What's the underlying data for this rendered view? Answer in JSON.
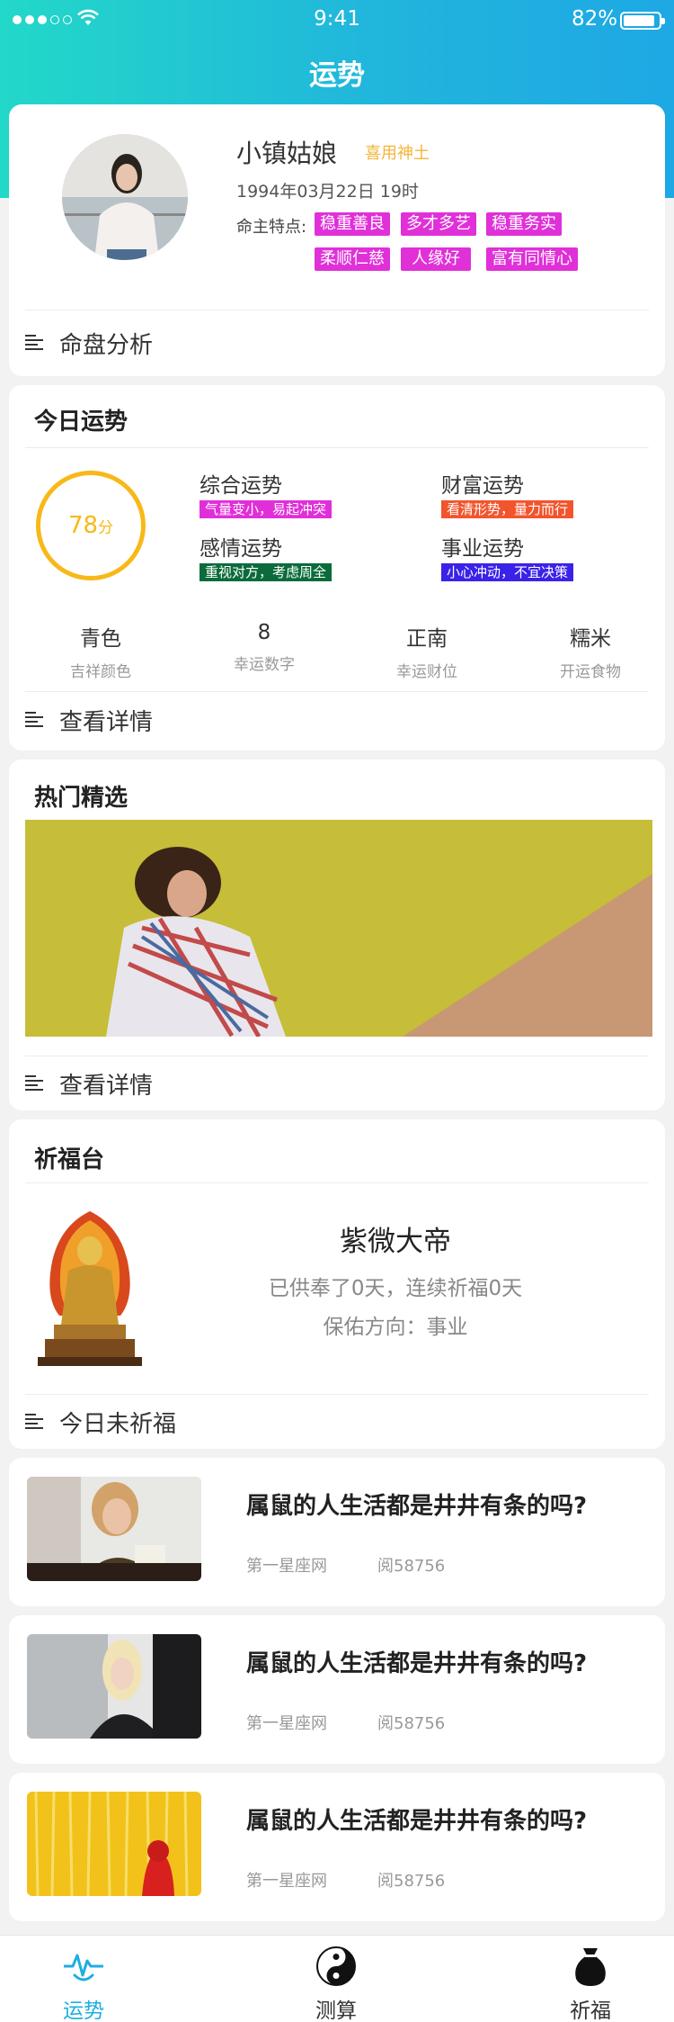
{
  "status_bar": {
    "time": "9:41",
    "battery": "82%"
  },
  "nav": {
    "title": "运势"
  },
  "profile": {
    "name": "小镇姑娘",
    "god": "喜用神土",
    "birth": "1994年03月22日  19时",
    "traits_label": "命主特点:",
    "traits": [
      "稳重善良",
      "多才多艺",
      "稳重务实",
      "柔顺仁慈",
      "人缘好",
      "富有同情心"
    ],
    "link": "命盘分析"
  },
  "today": {
    "title": "今日运势",
    "score": "78",
    "score_unit": "分",
    "items": [
      {
        "title": "综合运势",
        "desc": "气量变小，易起冲突",
        "color": "#e02fd8"
      },
      {
        "title": "财富运势",
        "desc": "看清形势，量力而行",
        "color": "#f2552d"
      },
      {
        "title": "感情运势",
        "desc": "重视对方，考虑周全",
        "color": "#0b6b3b"
      },
      {
        "title": "事业运势",
        "desc": "小心冲动，不宜决策",
        "color": "#3a22e8"
      }
    ],
    "lucky": [
      {
        "value": "青色",
        "label": "吉祥颜色"
      },
      {
        "value": "8",
        "label": "幸运数字"
      },
      {
        "value": "正南",
        "label": "幸运财位"
      },
      {
        "value": "糯米",
        "label": "开运食物"
      }
    ],
    "link": "查看详情"
  },
  "hot": {
    "title": "热门精选",
    "link": "查看详情"
  },
  "prayer": {
    "title": "祈福台",
    "deity": "紫微大帝",
    "status": "已供奉了0天，连续祈福0天",
    "direction": "保佑方向：事业",
    "link": "今日未祈福"
  },
  "articles": [
    {
      "title": "属鼠的人生活都是井井有条的吗?",
      "source": "第一星座网",
      "reads": "阅58756"
    },
    {
      "title": "属鼠的人生活都是井井有条的吗?",
      "source": "第一星座网",
      "reads": "阅58756"
    },
    {
      "title": "属鼠的人生活都是井井有条的吗?",
      "source": "第一星座网",
      "reads": "阅58756"
    }
  ],
  "tabs": [
    {
      "label": "运势",
      "icon": "pulse-face-icon"
    },
    {
      "label": "测算",
      "icon": "yin-yang-icon"
    },
    {
      "label": "祈福",
      "icon": "fortune-bag-icon"
    }
  ],
  "colors": {
    "accent": "#1eaee0",
    "tag": "#e030d8",
    "score": "#f8b818"
  }
}
